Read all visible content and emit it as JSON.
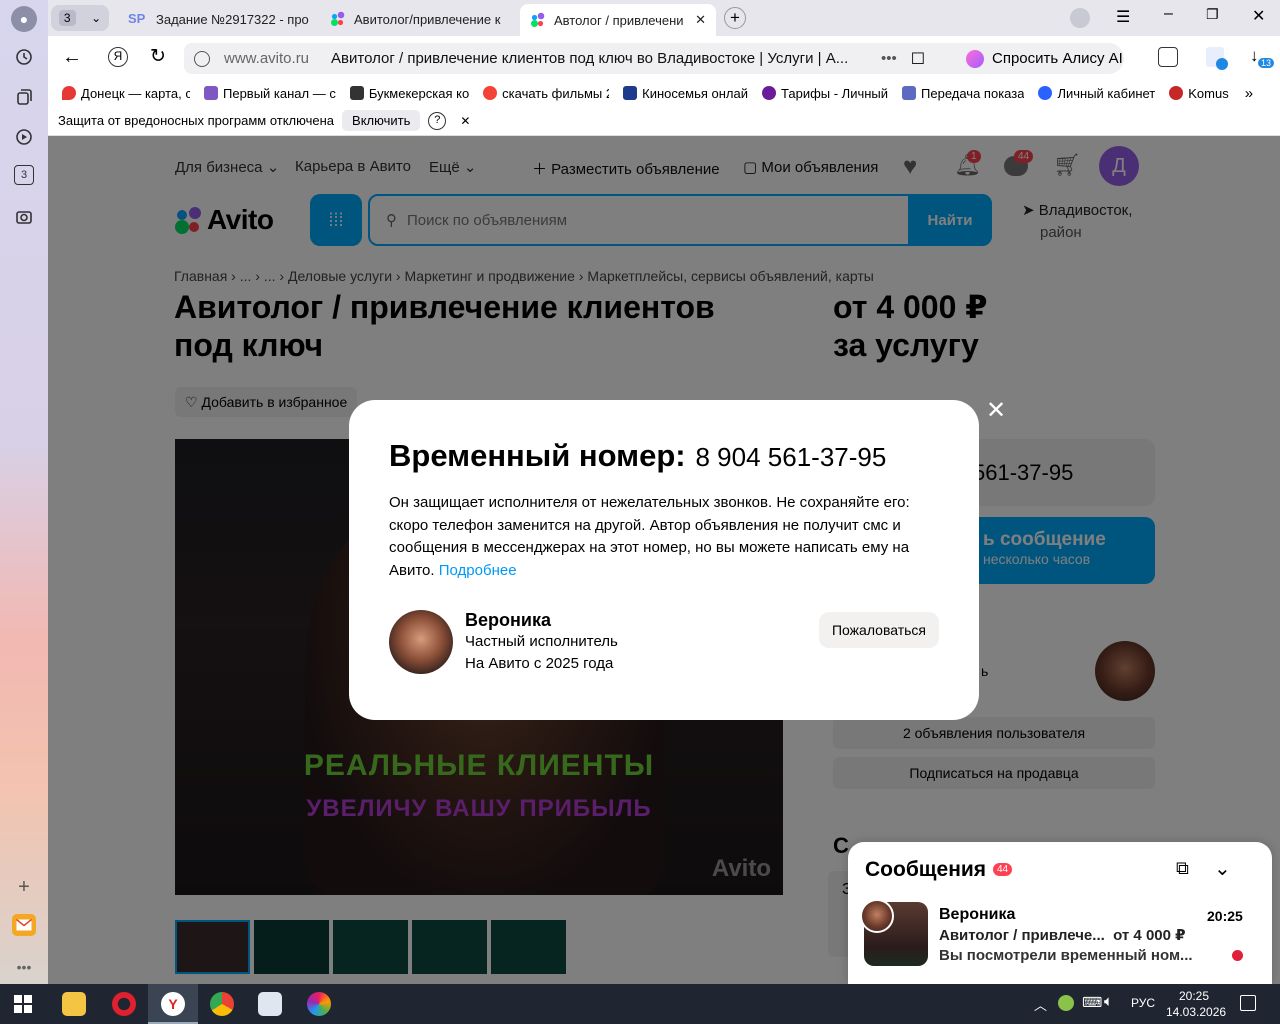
{
  "browser": {
    "tab_count_badge": "3",
    "tabs": [
      {
        "label": "Задание №2917322 - про",
        "color": "#6f86e6"
      },
      {
        "label": "Авитолог/привлечение к",
        "color": "#0aa5ff"
      },
      {
        "label": "Автолог / привлечени",
        "color": "#0aa5ff"
      }
    ],
    "url_host": "www.avito.ru",
    "page_title": "Авитолог / привлечение клиентов под ключ во Владивостоке | Услуги | А...",
    "alice_label": "Спросить Алису AI",
    "downloads_badge": "13",
    "bookmarks": [
      {
        "label": "Донецк — карта, с",
        "color": "#e53935"
      },
      {
        "label": "Первый канал — с",
        "color": "#7e57c2"
      },
      {
        "label": "Букмекерская ко",
        "color": "#333333"
      },
      {
        "label": "скачать фильмы 2",
        "color": "#f44336"
      },
      {
        "label": "Киносемья онлай",
        "color": "#1e3a8a"
      },
      {
        "label": "Тарифы - Личный",
        "color": "#6a1b9a"
      },
      {
        "label": "Передача показа",
        "color": "#5c6bc0"
      },
      {
        "label": "Личный кабинет",
        "color": "#2962ff"
      },
      {
        "label": "Komus",
        "color": "#c62828"
      }
    ],
    "infobar": {
      "text": "Защита от вредоносных программ отключена",
      "button": "Включить",
      "help": "?",
      "close": "✕"
    }
  },
  "site": {
    "top_nav": {
      "business": "Для бизнеса",
      "career": "Карьера в Авито",
      "more": "Ещё",
      "post_ad": "Разместить объявление",
      "my_ads": "Мои объявления",
      "notif_badge": "1",
      "msg_badge": "44",
      "avatar_letter": "Д"
    },
    "logo": "Avito",
    "search_placeholder": "Поиск по объявлениям",
    "search_button": "Найти",
    "location_line1": "Владивосток,",
    "location_line2": "район",
    "breadcrumbs": [
      "Главная",
      "...",
      "...",
      "Деловые услуги",
      "Маркетинг и продвижение",
      "Маркетплейсы, сервисы объявлений, карты"
    ],
    "title_line1": "Авитолог / привлечение клиентов",
    "title_line2": "под ключ",
    "price_line1": "от 4 000 ₽",
    "price_line2": "за услугу",
    "favorite": "Добавить в избранное",
    "phone_partial": "561-37-95",
    "write_line1": "ь сообщение",
    "write_line2": "несколько часов",
    "seller_partial": "ь",
    "user_ads": "2 объявления пользователя",
    "subscribe": "Подписаться на продавца",
    "image_text1": "РЕАЛЬНЫЕ КЛИЕНТЫ",
    "image_text2": "УВЕЛИЧУ ВАШУ ПРИБЫЛЬ",
    "image_watermark": "Avito",
    "section_letter": "С",
    "section_letter2": "З"
  },
  "modal": {
    "title": "Временный номер:",
    "phone": "8 904 561-37-95",
    "description": "Он защищает исполнителя от нежелательных звонков. Не сохраняйте его: скоро телефон заменится на другой. Автор объявления не получит смс и сообщения в мессенджерах на этот номер, но вы можете написать ему на Авито.",
    "more_link": "Подробнее",
    "seller_name": "Вероника",
    "seller_type": "Частный исполнитель",
    "seller_since": "На Авито с 2025 года",
    "report_button": "Пожаловаться",
    "close": "✕"
  },
  "messages_panel": {
    "title": "Сообщения",
    "badge": "44",
    "name": "Вероника",
    "time": "20:25",
    "ad_title": "Авитолог / привлече...",
    "ad_price": "от 4 000 ₽",
    "preview": "Вы посмотрели временный ном..."
  },
  "taskbar": {
    "lang": "РУС",
    "time": "20:25",
    "date": "14.03.2026"
  }
}
